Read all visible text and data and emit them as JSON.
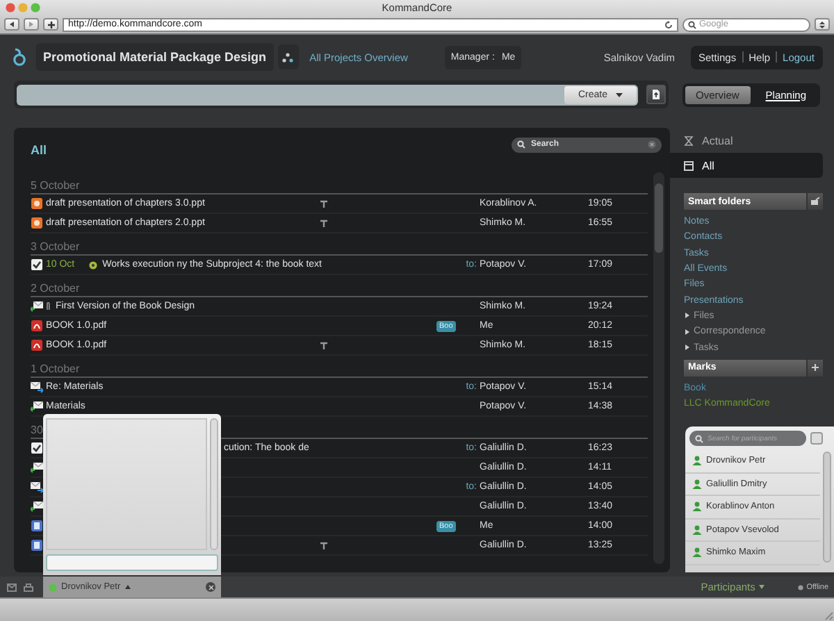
{
  "window": {
    "title": "KommandCore"
  },
  "browser": {
    "url": "http://demo.kommandcore.com",
    "search_placeholder": "Google"
  },
  "header": {
    "project_title": "Promotional Material Package Design",
    "overview_link": "All Projects Overview",
    "manager_label": "Manager :",
    "manager": "Me",
    "user": "Salnikov Vadim",
    "menu": [
      "Settings",
      "Help",
      "Logout"
    ]
  },
  "command_bar": {
    "create_button": "Create",
    "views": [
      {
        "label": "Overview",
        "selected": true
      },
      {
        "label": "Planning",
        "selected": false
      }
    ]
  },
  "list": {
    "title": "All",
    "search_placeholder": "Search",
    "sections": [
      {
        "date": "5 October",
        "rows": [
          {
            "kind": "ppt",
            "title": "draft presentation of chapters 3.0.ppt",
            "pinned": true,
            "sender": "Korablinov A.",
            "time": "19:05"
          },
          {
            "kind": "ppt",
            "title": "draft presentation of chapters 2.0.ppt",
            "pinned": true,
            "sender": "Shimko M.",
            "time": "16:55"
          }
        ]
      },
      {
        "date": "3 October",
        "rows": [
          {
            "kind": "task",
            "due": "10 Oct",
            "title": "Works execution ny the Subproject 4: the book text",
            "prefix": "to:",
            "sender": "Potapov V.",
            "time": "17:09"
          }
        ]
      },
      {
        "date": "2 October",
        "rows": [
          {
            "kind": "mail-in",
            "attachment": true,
            "title": "First Version of the Book Design",
            "sender": "Shimko M.",
            "time": "19:24"
          },
          {
            "kind": "pdf",
            "title": "BOOK 1.0.pdf",
            "tag": "Boo",
            "sender": "Me",
            "time": "20:12"
          },
          {
            "kind": "pdf",
            "title": "BOOK 1.0.pdf",
            "pinned": true,
            "sender": "Shimko M.",
            "time": "18:15"
          }
        ]
      },
      {
        "date": "1 October",
        "rows": [
          {
            "kind": "mail-out",
            "title": "Re: Materials",
            "prefix": "to:",
            "sender": "Potapov V.",
            "time": "15:14"
          },
          {
            "kind": "mail-in",
            "title": "Materials",
            "sender": "Potapov V.",
            "time": "14:38"
          }
        ]
      },
      {
        "date": "30",
        "rows": [
          {
            "kind": "task",
            "covered": true,
            "title": "cution: The book de",
            "prefix": "to:",
            "sender": "Galiullin D.",
            "time": "16:23"
          },
          {
            "kind": "mail-in",
            "covered": true,
            "sender": "Galiullin D.",
            "time": "14:11"
          },
          {
            "kind": "mail-out",
            "covered": true,
            "prefix": "to:",
            "sender": "Galiullin D.",
            "time": "14:05"
          },
          {
            "kind": "mail-in",
            "covered": true,
            "sender": "Galiullin D.",
            "time": "13:40"
          },
          {
            "kind": "doc",
            "covered": true,
            "tag": "Boo",
            "sender": "Me",
            "time": "14:00"
          },
          {
            "kind": "doc",
            "covered": true,
            "pinned": true,
            "sender": "Galiullin D.",
            "time": "13:25"
          }
        ]
      }
    ]
  },
  "sidebar": {
    "views": [
      {
        "label": "Actual",
        "selected": false
      },
      {
        "label": "All",
        "selected": true
      }
    ],
    "smart_folders": {
      "title": "Smart folders",
      "items": [
        {
          "label": "Notes",
          "kind": "link"
        },
        {
          "label": "Contacts",
          "kind": "link"
        },
        {
          "label": "Tasks",
          "kind": "link"
        },
        {
          "label": "All Events",
          "kind": "link"
        },
        {
          "label": "Files",
          "kind": "link"
        },
        {
          "label": "Presentations",
          "kind": "link"
        },
        {
          "label": "Files",
          "kind": "sub"
        },
        {
          "label": "Correspondence",
          "kind": "sub"
        },
        {
          "label": "Tasks",
          "kind": "sub"
        }
      ]
    },
    "marks": {
      "title": "Marks",
      "items": [
        {
          "label": "Book",
          "color": "#4f8fa8"
        },
        {
          "label": "LLC KommandCore",
          "color": "#6a9a2a"
        }
      ]
    }
  },
  "participants": {
    "search_placeholder": "Search for participants",
    "people": [
      "Drovnikov Petr",
      "Galiullin Dmitry",
      "Korablinov Anton",
      "Potapov Vsevolod",
      "Shimko Maxim"
    ],
    "menu_label": "Participants",
    "status": "Offline"
  },
  "chat": {
    "contact": "Drovnikov Petr",
    "online": true
  }
}
